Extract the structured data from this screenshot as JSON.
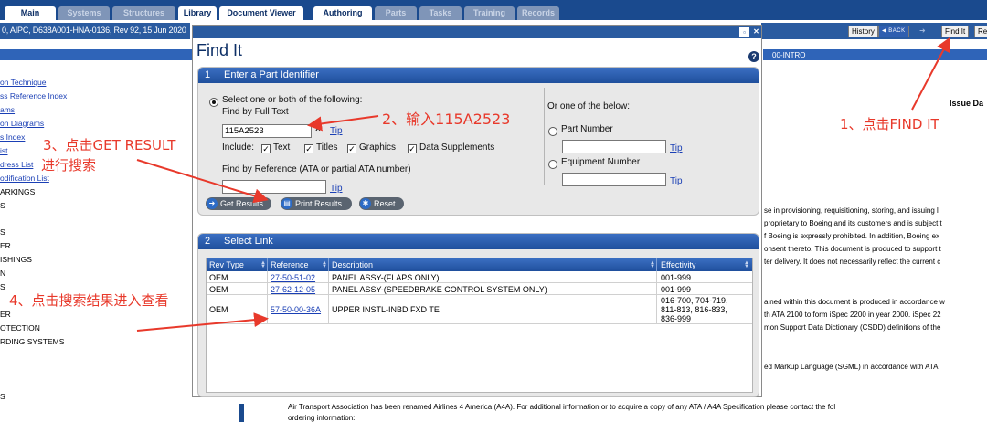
{
  "tabs": [
    {
      "label": "Main",
      "active": true
    },
    {
      "label": "Systems",
      "active": false
    },
    {
      "label": "Structures",
      "active": false
    },
    {
      "label": "Library",
      "active": true
    },
    {
      "label": "Document Viewer",
      "active": true
    },
    {
      "label": "Authoring",
      "active": true
    },
    {
      "label": "Parts",
      "active": false
    },
    {
      "label": "Tasks",
      "active": false
    },
    {
      "label": "Training",
      "active": false
    },
    {
      "label": "Records",
      "active": false
    }
  ],
  "doc_info": "0, AIPC, D638A001-HNA-0136, Rev 92, 15 Jun 2020",
  "header_buttons": {
    "history": "History",
    "back": "◀ BACK",
    "find_it": "Find It",
    "re": "Re"
  },
  "intro_label": "00-INTRO",
  "toc": [
    {
      "text": "on Technique",
      "link": true
    },
    {
      "text": "ss Reference Index",
      "link": true
    },
    {
      "text": "ams",
      "link": true
    },
    {
      "text": "on Diagrams",
      "link": true
    },
    {
      "text": "s Index",
      "link": true
    },
    {
      "text": "ist",
      "link": true
    },
    {
      "text": "dress List",
      "link": true
    },
    {
      "text": "odification List",
      "link": true
    },
    {
      "text": "ARKINGS",
      "link": false
    },
    {
      "text": "S",
      "link": false
    },
    {
      "text": "S",
      "link": false
    },
    {
      "text": "ER",
      "link": false
    },
    {
      "text": "ISHINGS",
      "link": false
    },
    {
      "text": "N",
      "link": false
    },
    {
      "text": "S",
      "link": false
    },
    {
      "text": "ER",
      "link": false
    },
    {
      "text": "OTECTION",
      "link": false
    },
    {
      "text": "RDING SYSTEMS",
      "link": false
    },
    {
      "text": "S",
      "link": false
    }
  ],
  "doc": {
    "issue_label": "Issue Da",
    "para1": [
      "se in provisioning, requisitioning, storing, and issuing li",
      "proprietary to Boeing and its customers and is subject t",
      "f Boeing is expressly prohibited. In addition, Boeing ex",
      "onsent thereto. This document is produced to support t",
      "ter delivery. It does not necessarily reflect the current c"
    ],
    "para2": [
      "ained within this document is produced in accordance w",
      "th ATA 2100 to form iSpec 2200 in year 2000. iSpec 22",
      "mon Support Data Dictionary (CSDD) definitions of the"
    ],
    "para3": [
      "ed Markup Language (SGML) in accordance with ATA"
    ],
    "bottom1": "Air Transport Association has been renamed Airlines 4 America (A4A). For additional information or to acquire a copy of any ATA / A4A Specification please contact the fol",
    "bottom2": "ordering information:"
  },
  "dialog": {
    "title": "Find It",
    "help": "?",
    "sec1": {
      "num": "1",
      "title": "Enter a Part Identifier",
      "select_prompt": "Select one or both of the following:",
      "full_text_label": "Find by Full Text",
      "full_text_value": "115A2523",
      "clear": "×",
      "tip": "Tip",
      "include_label": "Include:",
      "checks": [
        "Text",
        "Titles",
        "Graphics",
        "Data Supplements"
      ],
      "ref_label": "Find by Reference (ATA or partial ATA number)",
      "ref_value": "",
      "alt_prompt": "Or one of the below:",
      "part_number_label": "Part Number",
      "equipment_number_label": "Equipment Number",
      "buttons": {
        "get": "Get Results",
        "print": "Print Results",
        "reset": "Reset"
      }
    },
    "sec2": {
      "num": "2",
      "title": "Select Link",
      "columns": [
        "Rev Type",
        "Reference",
        "Description",
        "Effectivity"
      ],
      "rows": [
        {
          "rev": "OEM",
          "ref": "27-50-51-02",
          "desc": "PANEL ASSY-(FLAPS ONLY)",
          "eff": [
            "001-999"
          ]
        },
        {
          "rev": "OEM",
          "ref": "27-62-12-05",
          "desc": "PANEL ASSY-(SPEEDBRAKE CONTROL SYSTEM ONLY)",
          "eff": [
            "001-999"
          ]
        },
        {
          "rev": "OEM",
          "ref": "57-50-00-36A",
          "desc": "UPPER INSTL-INBD FXD TE",
          "eff": [
            "016-700, 704-719,",
            "811-813, 816-833,",
            "836-999"
          ]
        }
      ]
    }
  },
  "callouts": {
    "step1": "1、点击FIND IT",
    "step2": "2、输入115A2523",
    "step3_line1": "3、点击GET RESULT",
    "step3_line2": "进行搜索",
    "step4": "4、点击搜索结果进入查看",
    "color": "#e8392b"
  }
}
